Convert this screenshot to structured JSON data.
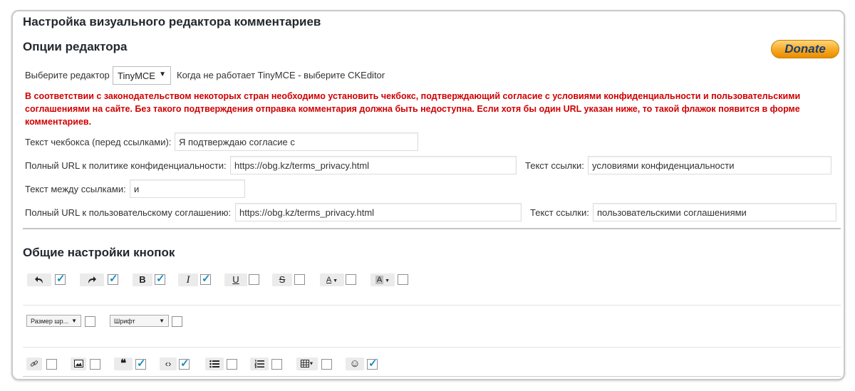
{
  "page_title": "Настройка визуального редактора комментариев",
  "editor_options": {
    "title": "Опции редактора",
    "donate_label": "Donate",
    "choose_editor_label": "Выберите редактор",
    "editor_selected": "TinyMCE",
    "editor_hint": "Когда не работает TinyMCE - выберите CKEditor",
    "warning": "В соответствии с законодательством некоторых стран необходимо установить чекбокс, подтверждающий согласие с условиями конфиденциальности и пользовательскими соглашениями на сайте. Без такого подтверждения отправка комментария должна быть недоступна. Если хотя бы один URL указан ниже, то такой флажок появится в форме комментариев.",
    "checkbox_text_label": "Текст чекбокса (перед ссылками):",
    "checkbox_text_value": "Я подтверждаю согласие с",
    "privacy_url_label": "Полный URL к политике конфиденциальности:",
    "privacy_url_value": "https://obg.kz/terms_privacy.html",
    "privacy_link_text_label": "Текст ссылки:",
    "privacy_link_text_value": "условиями конфиденциальности",
    "between_links_label": "Текст между ссылками:",
    "between_links_value": "и",
    "agreement_url_label": "Полный URL к пользовательскому соглашению:",
    "agreement_url_value": "https://obg.kz/terms_privacy.html",
    "agreement_link_text_label": "Текст ссылки:",
    "agreement_link_text_value": "пользовательскими соглашениями"
  },
  "buttons_section": {
    "title": "Общие настройки кнопок",
    "row1": [
      {
        "icon": "undo-icon",
        "checked": true
      },
      {
        "icon": "redo-icon",
        "checked": true
      },
      {
        "icon": "bold-icon",
        "label": "B",
        "checked": true
      },
      {
        "icon": "italic-icon",
        "label": "I",
        "checked": true
      },
      {
        "icon": "underline-icon",
        "label": "U",
        "checked": false
      },
      {
        "icon": "strikethrough-icon",
        "label": "S",
        "checked": false
      },
      {
        "icon": "text-color-icon",
        "label": "A",
        "checked": false
      },
      {
        "icon": "background-color-icon",
        "label": "A",
        "checked": false
      }
    ],
    "row2": [
      {
        "label": "Размер шр...",
        "checked": false
      },
      {
        "label": "Шрифт",
        "checked": false
      }
    ],
    "row3": [
      {
        "icon": "link-icon",
        "checked": false
      },
      {
        "icon": "image-icon",
        "checked": false
      },
      {
        "icon": "blockquote-icon",
        "label": "❝",
        "checked": true
      },
      {
        "icon": "code-icon",
        "label": "‹›",
        "checked": true
      },
      {
        "icon": "bullet-list-icon",
        "checked": false
      },
      {
        "icon": "numbered-list-icon",
        "checked": false
      },
      {
        "icon": "table-icon",
        "checked": false
      },
      {
        "icon": "emoticons-icon",
        "label": "☺",
        "checked": true
      }
    ]
  }
}
